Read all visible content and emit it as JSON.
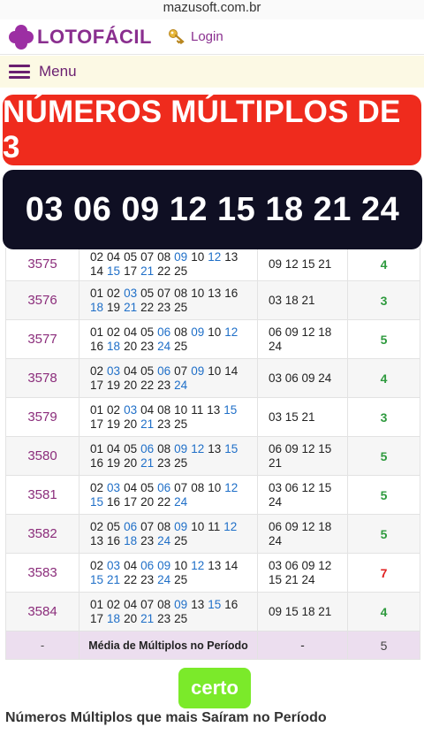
{
  "browser": {
    "url": "mazusoft.com.br"
  },
  "header": {
    "logo_text": "LOTOFÁCIL",
    "login_label": "Login"
  },
  "menu": {
    "label": "Menu"
  },
  "overlay": {
    "title": "NÚMEROS MÚLTIPLOS DE 3",
    "numbers": "03 06 09 12 15 18 21 24"
  },
  "table": {
    "rows": [
      {
        "contest": "3575",
        "numbers": [
          "02",
          "04",
          "05",
          "07",
          "08",
          "09",
          "10",
          "12",
          "13",
          "14",
          "15",
          "17",
          "21",
          "22",
          "25"
        ],
        "multiples": "09 12 15 21",
        "count": "4",
        "count_color": "#2e9a3e",
        "height": 44
      },
      {
        "contest": "3576",
        "numbers": [
          "01",
          "02",
          "03",
          "05",
          "07",
          "08",
          "10",
          "13",
          "16",
          "18",
          "19",
          "21",
          "22",
          "23",
          "25"
        ],
        "multiples": "03 18 21",
        "count": "3",
        "count_color": "#2e9a3e",
        "height": 44
      },
      {
        "contest": "3577",
        "numbers": [
          "01",
          "02",
          "04",
          "05",
          "06",
          "08",
          "09",
          "10",
          "12",
          "16",
          "18",
          "20",
          "23",
          "24",
          "25"
        ],
        "multiples": "06 09 12 18 24",
        "count": "5",
        "count_color": "#2e9a3e",
        "height": 44
      },
      {
        "contest": "3578",
        "numbers": [
          "02",
          "03",
          "04",
          "05",
          "06",
          "07",
          "09",
          "10",
          "14",
          "17",
          "19",
          "20",
          "22",
          "23",
          "24"
        ],
        "multiples": "03 06 09 24",
        "count": "4",
        "count_color": "#2e9a3e",
        "height": 44
      },
      {
        "contest": "3579",
        "numbers": [
          "01",
          "02",
          "03",
          "04",
          "08",
          "10",
          "11",
          "13",
          "15",
          "17",
          "19",
          "20",
          "21",
          "23",
          "25"
        ],
        "multiples": "03 15 21",
        "count": "3",
        "count_color": "#2e9a3e",
        "height": 44
      },
      {
        "contest": "3580",
        "numbers": [
          "01",
          "04",
          "05",
          "06",
          "08",
          "09",
          "12",
          "13",
          "15",
          "16",
          "19",
          "20",
          "21",
          "23",
          "25"
        ],
        "multiples": "06 09 12 15 21",
        "count": "5",
        "count_color": "#2e9a3e",
        "height": 44
      },
      {
        "contest": "3581",
        "numbers": [
          "02",
          "03",
          "04",
          "05",
          "06",
          "07",
          "08",
          "10",
          "12",
          "15",
          "16",
          "17",
          "20",
          "22",
          "24"
        ],
        "multiples": "03 06 12 15 24",
        "count": "5",
        "count_color": "#2e9a3e",
        "height": 44
      },
      {
        "contest": "3582",
        "numbers": [
          "02",
          "05",
          "06",
          "07",
          "08",
          "09",
          "10",
          "11",
          "12",
          "13",
          "16",
          "18",
          "23",
          "24",
          "25"
        ],
        "multiples": "06 09 12 18 24",
        "count": "5",
        "count_color": "#2e9a3e",
        "height": 44
      },
      {
        "contest": "3583",
        "numbers": [
          "02",
          "03",
          "04",
          "06",
          "09",
          "10",
          "12",
          "13",
          "14",
          "15",
          "21",
          "22",
          "23",
          "24",
          "25"
        ],
        "multiples": "03 06 09 12 15 21 24",
        "count": "7",
        "count_color": "#e02020",
        "height": 44
      },
      {
        "contest": "3584",
        "numbers": [
          "01",
          "02",
          "04",
          "07",
          "08",
          "09",
          "13",
          "15",
          "16",
          "17",
          "18",
          "20",
          "21",
          "23",
          "25"
        ],
        "multiples": "09 15 18 21",
        "count": "4",
        "count_color": "#2e9a3e",
        "height": 44
      }
    ],
    "average": {
      "dash1": "-",
      "label": "Média de Múltiplos no Período",
      "dash2": "-",
      "value": "5"
    }
  },
  "highlight_color": "#1f6fc8",
  "button": {
    "label": "certo"
  },
  "footer": {
    "heading": "Números Múltiplos que mais Saíram no Período"
  }
}
